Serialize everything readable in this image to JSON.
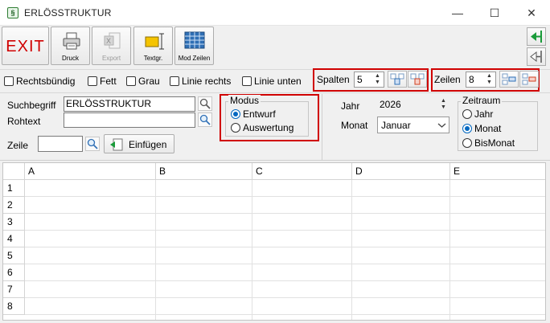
{
  "window": {
    "title": "ERLÖSSTRUKTUR",
    "icon_glyph": "§",
    "controls": {
      "minimize": "—",
      "maximize": "☐",
      "close": "✕"
    }
  },
  "toolbar": {
    "exit_label": "EXIT",
    "druck_label": "Druck",
    "export_label": "Export",
    "textgr_label": "Textgr.",
    "modzeilen_label": "Mod Zeilen"
  },
  "options": {
    "rechtsbuendig": "Rechtsbündig",
    "fett": "Fett",
    "grau": "Grau",
    "linie_rechts": "Linie rechts",
    "linie_unten": "Linie unten"
  },
  "spalten": {
    "label": "Spalten",
    "value": "5"
  },
  "zeilen": {
    "label": "Zeilen",
    "value": "8"
  },
  "form": {
    "suchbegriff_label": "Suchbegriff",
    "suchbegriff_value": "ERLÖSSTRUKTUR",
    "rohtext_label": "Rohtext",
    "rohtext_value": "",
    "zeile_label": "Zeile",
    "zeile_value": "",
    "einfuegen_label": "Einfügen"
  },
  "modus": {
    "title": "Modus",
    "options": [
      "Entwurf",
      "Auswertung"
    ],
    "selected": "Entwurf"
  },
  "jahr": {
    "label": "Jahr",
    "value": "2026"
  },
  "monat": {
    "label": "Monat",
    "value": "Januar"
  },
  "zeitraum": {
    "title": "Zeitraum",
    "options": [
      "Jahr",
      "Monat",
      "BisMonat"
    ],
    "selected": "Monat"
  },
  "grid": {
    "columns": [
      "A",
      "B",
      "C",
      "D",
      "E"
    ],
    "rows": [
      "1",
      "2",
      "3",
      "4",
      "5",
      "6",
      "7",
      "8"
    ]
  },
  "colors": {
    "highlight": "#d00000",
    "accent": "#0067c0"
  }
}
